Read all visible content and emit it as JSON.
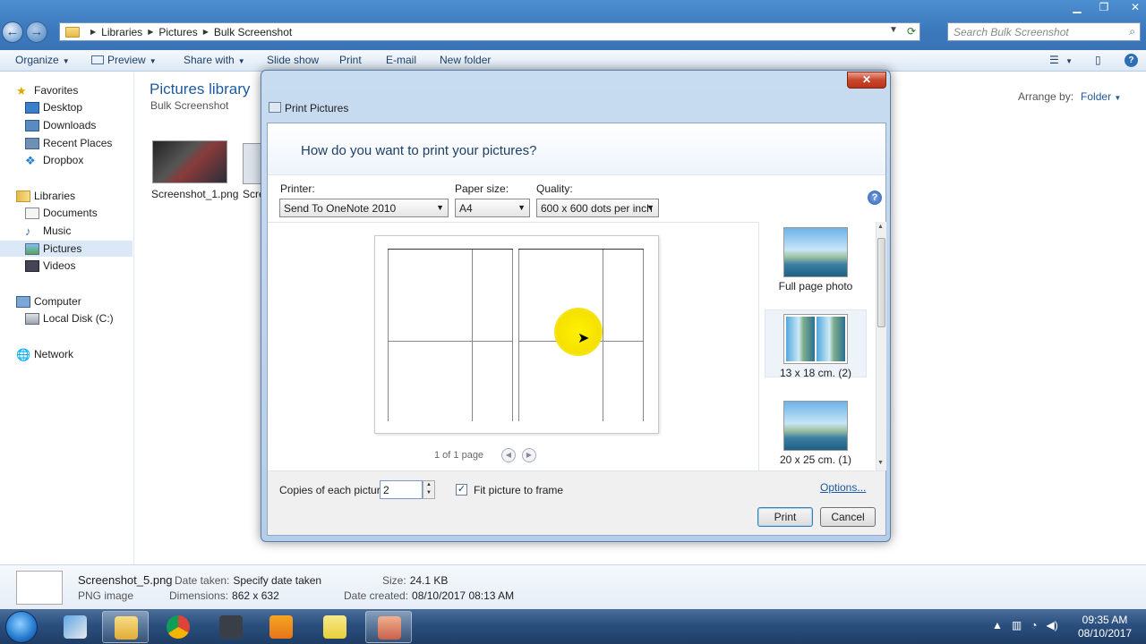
{
  "window": {
    "breadcrumb": [
      "Libraries",
      "Pictures",
      "Bulk Screenshot"
    ],
    "search_placeholder": "Search Bulk Screenshot"
  },
  "toolbar": {
    "organize": "Organize",
    "preview": "Preview",
    "share_with": "Share with",
    "slide_show": "Slide show",
    "print": "Print",
    "email": "E-mail",
    "new_folder": "New folder"
  },
  "sidebar": {
    "favorites": "Favorites",
    "desktop": "Desktop",
    "downloads": "Downloads",
    "recent_places": "Recent Places",
    "dropbox": "Dropbox",
    "libraries": "Libraries",
    "documents": "Documents",
    "music": "Music",
    "pictures": "Pictures",
    "videos": "Videos",
    "computer": "Computer",
    "local_disk": "Local Disk (C:)",
    "network": "Network"
  },
  "main": {
    "title": "Pictures library",
    "subtitle": "Bulk Screenshot",
    "arrange_by_label": "Arrange by:",
    "arrange_by_value": "Folder",
    "files": [
      "Screenshot_1.png",
      "Scre"
    ]
  },
  "details": {
    "file_name": "Screenshot_5.png",
    "file_type": "PNG image",
    "date_taken_label": "Date taken:",
    "date_taken_value": "Specify date taken",
    "dimensions_label": "Dimensions:",
    "dimensions_value": "862 x 632",
    "size_label": "Size:",
    "size_value": "24.1 KB",
    "date_created_label": "Date created:",
    "date_created_value": "08/10/2017 08:13 AM"
  },
  "taskbar": {
    "time": "09:35 AM",
    "date": "08/10/2017"
  },
  "dialog": {
    "title": "Print Pictures",
    "heading": "How do you want to print your pictures?",
    "printer_label": "Printer:",
    "printer_value": "Send To OneNote 2010",
    "paper_label": "Paper size:",
    "paper_value": "A4",
    "quality_label": "Quality:",
    "quality_value": "600 x 600 dots per inch",
    "page_count": "1 of 1 page",
    "layouts": [
      "Full page photo",
      "13 x 18 cm. (2)",
      "20 x 25 cm. (1)"
    ],
    "copies_label": "Copies of each picture:",
    "copies_value": "2",
    "fit_label": "Fit picture to frame",
    "options_link": "Options...",
    "print_button": "Print",
    "cancel_button": "Cancel"
  }
}
